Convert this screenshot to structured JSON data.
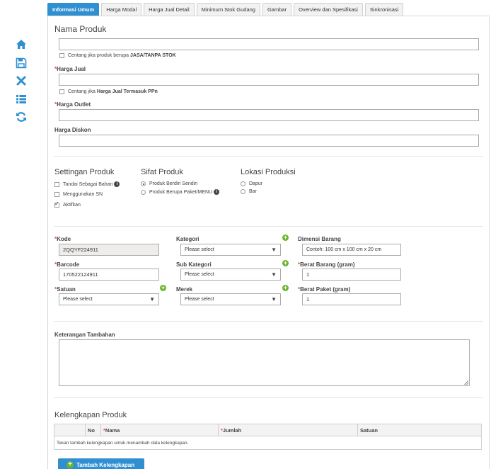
{
  "colors": {
    "accent": "#2f8fd1",
    "plus": "#6ab42d",
    "required": "#d9534f"
  },
  "sidebar": [
    {
      "icon": "home-icon"
    },
    {
      "icon": "save-icon"
    },
    {
      "icon": "close-icon"
    },
    {
      "icon": "list-icon"
    },
    {
      "icon": "refresh-icon"
    }
  ],
  "tabs": [
    "Informasi Umum",
    "Harga Modal",
    "Harga Jual Detail",
    "Minimum Stok Gudang",
    "Gambar",
    "Overview dan Spesifikasi",
    "Sinkronisasi"
  ],
  "form": {
    "nama_produk": {
      "title": "Nama Produk",
      "value": ""
    },
    "jasa_check": {
      "prefix": "Centang jika produk berupa",
      "bold": "JASA/TANPA STOK",
      "checked": false
    },
    "harga_jual": {
      "label": "Harga Jual",
      "value": ""
    },
    "ppn_check": {
      "prefix": "Centang jika",
      "bold": "Harga Jual Termasuk PPn",
      "checked": false
    },
    "harga_outlet": {
      "label": "Harga Outlet",
      "value": ""
    },
    "harga_diskon": {
      "label": "Harga Diskon",
      "value": ""
    }
  },
  "settings": {
    "title": "Settingan Produk",
    "items": [
      {
        "label": "Tandai Sebagai Bahan",
        "checked": false,
        "info": true
      },
      {
        "label": "Menggunakan SN",
        "checked": false
      },
      {
        "label": "Aktifkan",
        "checked": true
      }
    ]
  },
  "sifat": {
    "title": "Sifat Produk",
    "items": [
      {
        "label": "Produk Berdiri Sendiri",
        "selected": true
      },
      {
        "label": "Produk Berupa Paket/MENU",
        "selected": false,
        "info": true
      }
    ]
  },
  "lokasi": {
    "title": "Lokasi Produksi",
    "items": [
      {
        "label": "Dapur",
        "selected": false
      },
      {
        "label": "Bar",
        "selected": false
      }
    ]
  },
  "details": {
    "kode": {
      "label": "Kode",
      "value": "2QQYF224911"
    },
    "barcode": {
      "label": "Barcode",
      "value": "170522124911"
    },
    "satuan": {
      "label": "Satuan",
      "value": "Please select"
    },
    "kategori": {
      "label": "Kategori",
      "value": "Please select"
    },
    "sub_kategori": {
      "label": "Sub Kategori",
      "value": "Please select"
    },
    "merek": {
      "label": "Merek",
      "value": "Please select"
    },
    "dimensi": {
      "label": "Dimensi Barang",
      "value": "Contoh: 100 cm x 100 cm x 20 cm"
    },
    "berat_barang": {
      "label": "Berat Barang (gram)",
      "value": "1"
    },
    "berat_paket": {
      "label": "Berat Paket (gram)",
      "value": "1"
    }
  },
  "keterangan": {
    "label": "Keterangan Tambahan",
    "value": ""
  },
  "kelengkapan": {
    "title": "Kelengkapan Produk",
    "columns": [
      "",
      "No",
      "Nama",
      "Jumlah",
      "Satuan"
    ],
    "empty_text": "Tekan tambah kelengkapan untuk menambah data kelengkapan.",
    "add_button": "Tambah Kelengkapan"
  }
}
